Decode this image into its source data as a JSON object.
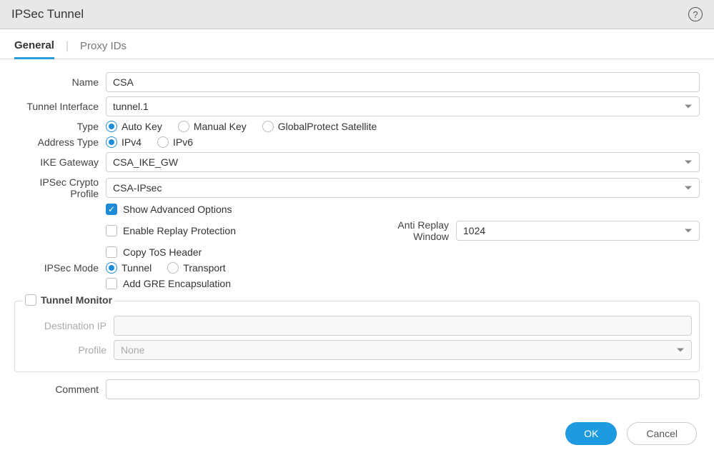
{
  "header": {
    "title": "IPSec Tunnel"
  },
  "tabs": {
    "general": "General",
    "proxy_ids": "Proxy IDs"
  },
  "labels": {
    "name": "Name",
    "tunnel_interface": "Tunnel Interface",
    "type": "Type",
    "address_type": "Address Type",
    "ike_gateway": "IKE Gateway",
    "ipsec_crypto_profile": "IPSec Crypto Profile",
    "ipsec_mode": "IPSec Mode",
    "anti_replay_window": "Anti Replay Window",
    "destination_ip": "Destination IP",
    "profile": "Profile",
    "comment": "Comment",
    "tunnel_monitor": "Tunnel Monitor"
  },
  "fields": {
    "name": "CSA",
    "tunnel_interface": "tunnel.1",
    "ike_gateway": "CSA_IKE_GW",
    "ipsec_crypto_profile": "CSA-IPsec",
    "anti_replay_window": "1024",
    "destination_ip": "",
    "profile": "None",
    "comment": ""
  },
  "radios": {
    "type": {
      "auto_key": "Auto Key",
      "manual_key": "Manual Key",
      "gp_satellite": "GlobalProtect Satellite"
    },
    "address_type": {
      "ipv4": "IPv4",
      "ipv6": "IPv6"
    },
    "ipsec_mode": {
      "tunnel": "Tunnel",
      "transport": "Transport"
    }
  },
  "checkboxes": {
    "show_advanced_options": "Show Advanced Options",
    "enable_replay_protection": "Enable Replay Protection",
    "copy_tos_header": "Copy ToS Header",
    "add_gre_encapsulation": "Add GRE Encapsulation"
  },
  "buttons": {
    "ok": "OK",
    "cancel": "Cancel"
  }
}
